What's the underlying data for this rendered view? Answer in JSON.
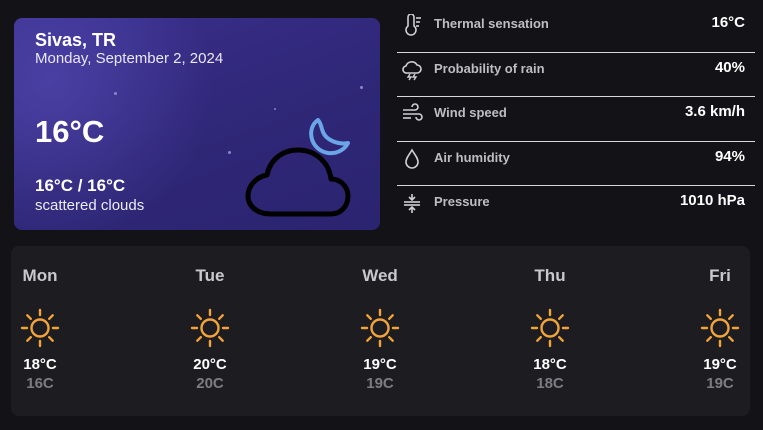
{
  "current": {
    "city": "Sivas, TR",
    "date": "Monday, September 2, 2024",
    "temperature": "16°C",
    "range": "16°C / 16°C",
    "description": "scattered clouds",
    "condition_icon": "night-cloud-moon-icon"
  },
  "details": [
    {
      "icon": "thermometer-icon",
      "label": "Thermal sensation",
      "value": "16°C"
    },
    {
      "icon": "rain-cloud-icon",
      "label": "Probability of rain",
      "value": "40%"
    },
    {
      "icon": "wind-icon",
      "label": "Wind speed",
      "value": "3.6 km/h"
    },
    {
      "icon": "droplet-icon",
      "label": "Air humidity",
      "value": "94%"
    },
    {
      "icon": "pressure-icon",
      "label": "Pressure",
      "value": "1010 hPa"
    }
  ],
  "forecast": [
    {
      "day": "Mon",
      "icon": "sun-icon",
      "high": "18°C",
      "low": "16C"
    },
    {
      "day": "Tue",
      "icon": "sun-icon",
      "high": "20°C",
      "low": "20C"
    },
    {
      "day": "Wed",
      "icon": "sun-icon",
      "high": "19°C",
      "low": "19C"
    },
    {
      "day": "Thu",
      "icon": "sun-icon",
      "high": "18°C",
      "low": "18C"
    },
    {
      "day": "Fri",
      "icon": "sun-icon",
      "high": "19°C",
      "low": "19C"
    }
  ],
  "colors": {
    "background": "#131317",
    "card_gradient_start": "#3a2f8c",
    "card_gradient_end": "#2b2470",
    "panel": "#1d1d21",
    "moon": "#6aa6e8",
    "sun": "#f2a33a",
    "muted_text": "#7c7c84"
  }
}
